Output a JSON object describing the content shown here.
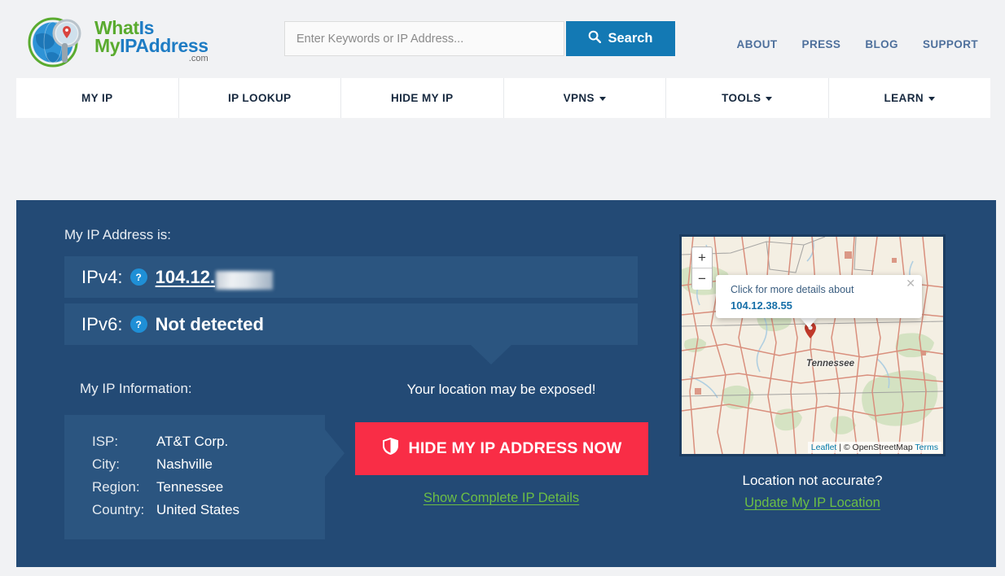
{
  "brand": {
    "line1_a": "What",
    "line1_b": "Is",
    "line2_a": "My",
    "line2_b": "IPAddress",
    "dotcom": ".com"
  },
  "search": {
    "placeholder": "Enter Keywords or IP Address...",
    "value": "",
    "button_label": "Search",
    "icon": "search-icon"
  },
  "toplinks": [
    {
      "label": "ABOUT"
    },
    {
      "label": "PRESS"
    },
    {
      "label": "BLOG"
    },
    {
      "label": "SUPPORT"
    }
  ],
  "nav": [
    {
      "label": "MY IP",
      "has_caret": false
    },
    {
      "label": "IP LOOKUP",
      "has_caret": false
    },
    {
      "label": "HIDE MY IP",
      "has_caret": false
    },
    {
      "label": "VPNS",
      "has_caret": true
    },
    {
      "label": "TOOLS",
      "has_caret": true
    },
    {
      "label": "LEARN",
      "has_caret": true
    }
  ],
  "panel": {
    "my_ip_heading": "My IP Address is:",
    "ipv4": {
      "label": "IPv4:",
      "help_icon": "question-mark-icon",
      "value": "104.12.",
      "redacted": true
    },
    "ipv6": {
      "label": "IPv6:",
      "help_icon": "question-mark-icon",
      "value": "Not detected"
    },
    "ip_info_heading": "My IP Information:",
    "info_rows": [
      {
        "key": "ISP:",
        "value": "AT&T Corp."
      },
      {
        "key": "City:",
        "value": "Nashville"
      },
      {
        "key": "Region:",
        "value": "Tennessee"
      },
      {
        "key": "Country:",
        "value": "United States"
      }
    ],
    "exposed_text": "Your location may be exposed!",
    "hide_button": {
      "label": "HIDE MY IP ADDRESS NOW",
      "icon": "shield-icon",
      "color": "#f92d46"
    },
    "show_details_link": "Show Complete IP Details"
  },
  "map": {
    "zoom_in": "+",
    "zoom_out": "−",
    "popup": {
      "line1": "Click for more details about",
      "ip": "104.12.38.55",
      "close_icon": "close-icon"
    },
    "marker_icon": "map-pin-icon",
    "state_label": "Tennessee",
    "attribution": {
      "leaflet": "Leaflet",
      "separator": " | ",
      "copyright": "© OpenStreetMap ",
      "terms": "Terms"
    },
    "location_question": "Location not accurate?",
    "update_link": "Update My IP Location"
  },
  "colors": {
    "page_bg": "#f1f2f4",
    "panel_bg": "#234a75",
    "panel_inner": "#2b5580",
    "accent_blue": "#1379b4",
    "accent_red": "#f92d46",
    "accent_green": "#6cbe45",
    "top_link": "#4e709c"
  }
}
